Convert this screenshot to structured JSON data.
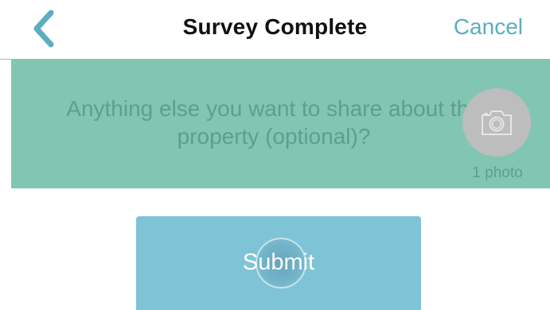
{
  "header": {
    "title": "Survey Complete",
    "cancel_label": "Cancel",
    "back_icon": "chevron-left-icon",
    "accent_color": "#5aaec0"
  },
  "question": {
    "text": "Anything else you want to share about the property (optional)?",
    "photo_count_label": "1 photo",
    "camera_icon": "camera-icon",
    "panel_color": "#80c6b3"
  },
  "submit": {
    "label": "Submit",
    "button_color": "#7fc4d6"
  }
}
